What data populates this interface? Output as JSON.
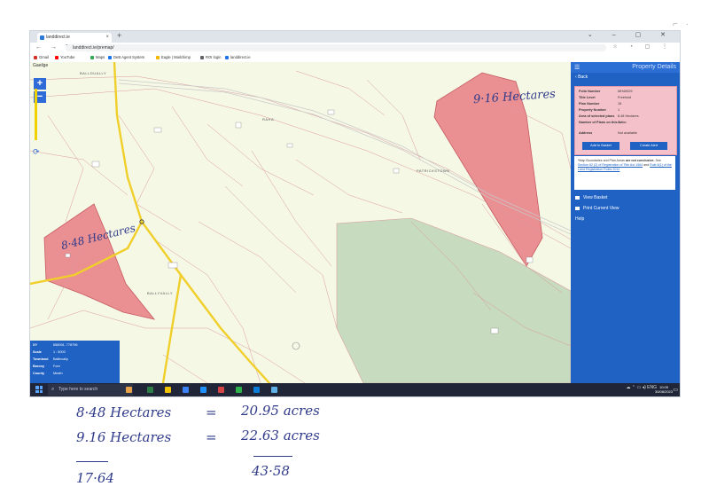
{
  "browser": {
    "tab_title": "landdirect.ie",
    "url": "landdirect.ie/premap/",
    "bookmarks": [
      "Gmail",
      "YouTube",
      "Maps",
      "DeB Agent System",
      "Eagle | Mailchimp",
      "ROI login",
      "landdirect.ie"
    ],
    "bookmark_colors": [
      "#d93025",
      "#ff0000",
      "#34a853",
      "#1a73e8",
      "#f4b400",
      "#5f6368",
      "#1a73e8"
    ]
  },
  "map": {
    "language_link": "Gaeilge",
    "zoom_in": "+",
    "zoom_out": "−",
    "annotation_left": "8·48 Hectares",
    "annotation_right": "9·16 Hectares",
    "place_labels": [
      "BALLDUALLY",
      "RAHA",
      "PATRICKSTOWN",
      "BALLYVALLY"
    ],
    "info": {
      "xy_label": "XY",
      "xy_value": "658091, 778796",
      "scale_label": "Scale",
      "scale_value": "1 : 5000",
      "townland_label": "Townland",
      "townland_value": "Ballinvally",
      "barony_label": "Barony",
      "barony_value": "Fore",
      "county_label": "County",
      "county_value": "Meath"
    }
  },
  "panel": {
    "title": "Property Details",
    "back": "Back",
    "folio_number_label": "Folio Number",
    "folio_number_value": "MH40029",
    "title_level_label": "Title Level",
    "title_level_value": "Freehold",
    "plan_number_label": "Plan Number",
    "plan_number_value": "15",
    "property_number_label": "Property Number",
    "property_number_value": "1",
    "area_label": "Area of selected plans",
    "area_value": "8.48 Hectares",
    "plans_count_label": "Number of Plans on this folio:",
    "plans_count_value": "2",
    "address_label": "Address",
    "address_value": "Not available",
    "add_to_basket": "Add to Basket",
    "create_alert": "Create Alert",
    "note_pre": "*Map Boundaries and Plan Areas",
    "note_bold": "are not conclusive.",
    "note_see": "See",
    "note_link1": "Section 62 (2) of Registration of Title Act 1964",
    "note_and": "and",
    "note_link2": "Rule 8(1) of the Land Registration Rules 2012",
    "view_basket": "View Basket",
    "print_view": "Print Current View",
    "help": "Help"
  },
  "taskbar": {
    "search_placeholder": "Type here to search",
    "tray": "ENG",
    "time": "10:05",
    "date": "30/08/2023",
    "app_colors": [
      "#e8a24a",
      "#2d7d46",
      "#f2c200",
      "#3b82f6",
      "#1e90ff",
      "#d64545",
      "#2db34a",
      "#0b7dd8",
      "#5fb0e6"
    ]
  },
  "handwritten_sums": {
    "row1_left": "8·48  Hectares",
    "row1_eq": "=",
    "row1_right": "20.95  acres",
    "row2_left": "9.16  Hectares",
    "row2_eq": "=",
    "row2_right": "22.63  acres",
    "total_left": "17·64",
    "total_right": "43·58"
  }
}
